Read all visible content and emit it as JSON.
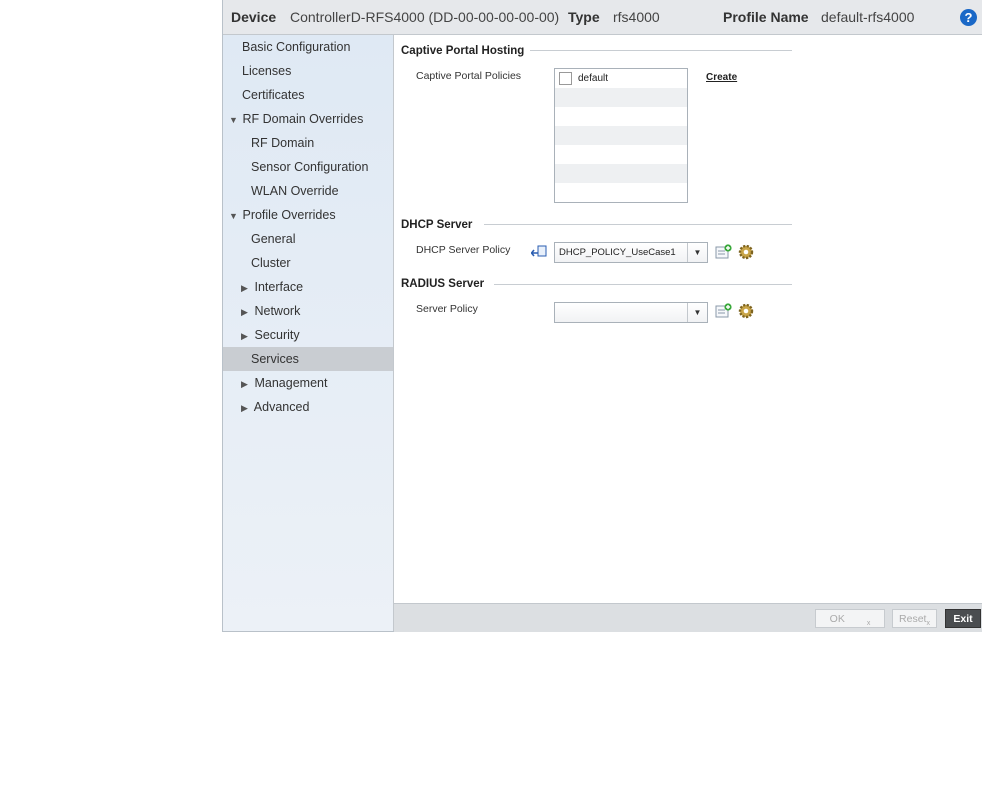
{
  "header": {
    "device_label": "Device",
    "device_value": "ControllerD-RFS4000 (DD-00-00-00-00-00)",
    "type_label": "Type",
    "type_value": "rfs4000",
    "profile_label": "Profile Name",
    "profile_value": "default-rfs4000",
    "help_glyph": "?"
  },
  "sidebar": {
    "items": [
      {
        "label": "Basic Configuration",
        "arrow": ""
      },
      {
        "label": "Licenses",
        "arrow": ""
      },
      {
        "label": "Certificates",
        "arrow": ""
      },
      {
        "label": "RF Domain Overrides",
        "arrow": "▼"
      },
      {
        "label": "RF Domain",
        "arrow": ""
      },
      {
        "label": "Sensor Configuration",
        "arrow": ""
      },
      {
        "label": "WLAN Override",
        "arrow": ""
      },
      {
        "label": "Profile Overrides",
        "arrow": "▼"
      },
      {
        "label": "General",
        "arrow": ""
      },
      {
        "label": "Cluster",
        "arrow": ""
      },
      {
        "label": "Interface",
        "arrow": "▶"
      },
      {
        "label": "Network",
        "arrow": "▶"
      },
      {
        "label": "Security",
        "arrow": "▶"
      },
      {
        "label": "Services",
        "arrow": ""
      },
      {
        "label": "Management",
        "arrow": "▶"
      },
      {
        "label": "Advanced",
        "arrow": "▶"
      }
    ],
    "selected": "Services"
  },
  "captive": {
    "title": "Captive Portal Hosting",
    "policies_label": "Captive Portal Policies",
    "policies": [
      "default"
    ],
    "create_link": "Create"
  },
  "dhcp": {
    "title": "DHCP Server",
    "policy_label": "DHCP Server Policy",
    "policy_value": "DHCP_POLICY_UseCase1"
  },
  "radius": {
    "title": "RADIUS Server",
    "policy_label": "Server Policy",
    "policy_value": ""
  },
  "footer": {
    "ok_label": "OK",
    "reset_label": "Reset",
    "exit_label": "Exit",
    "sub_mark": "x"
  },
  "colors": {
    "accent": "#1a68c7",
    "selected_nav": "#c9cdd2",
    "exit_button": "#4a4d50"
  },
  "icons": [
    "help-icon",
    "revert-icon",
    "add-policy-icon",
    "edit-policy-icon",
    "dropdown-arrow-icon"
  ]
}
